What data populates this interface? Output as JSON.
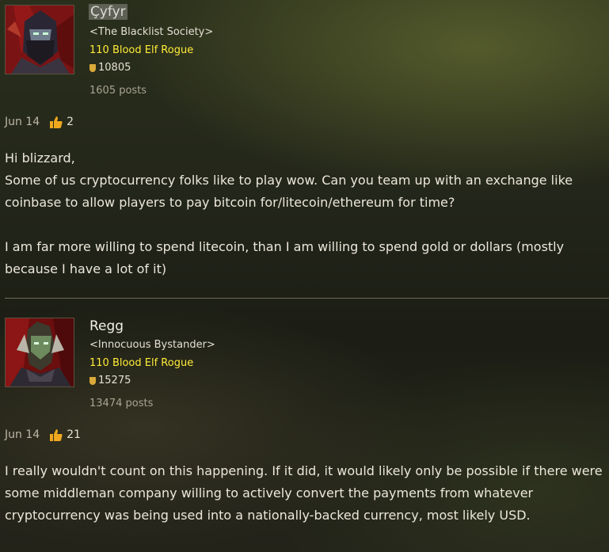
{
  "posts": [
    {
      "author": "Çyfyr",
      "guild": "<The Blacklist Society>",
      "character": "110 Blood Elf Rogue",
      "achievement_points": "10805",
      "post_count": "1605 posts",
      "date": "Jun 14",
      "likes": "2",
      "body": [
        "Hi blizzard,",
        "Some of us cryptocurrency folks like to play wow. Can you team up with an exchange like coinbase to allow players to pay bitcoin for/litecoin/ethereum for time?",
        "I am far more willing to spend litecoin, than I am willing to spend gold or dollars (mostly because I have a lot of it)"
      ]
    },
    {
      "author": "Regg",
      "guild": "<Innocuous Bystander>",
      "character": "110 Blood Elf Rogue",
      "achievement_points": "15275",
      "post_count": "13474 posts",
      "date": "Jun 14",
      "likes": "21",
      "body": [
        "I really wouldn't count on this happening. If it did, it would likely only be possible if there were some middleman company willing to actively convert the payments from whatever cryptocurrency was being used into a nationally-backed currency, most likely USD."
      ]
    }
  ],
  "colors": {
    "class_rogue": "#ffec38",
    "achievement_shield": "#d9a93a",
    "like_thumb": "#f0a81e"
  },
  "icons": {
    "like": "thumbs-up-icon",
    "achievement": "shield-icon"
  }
}
